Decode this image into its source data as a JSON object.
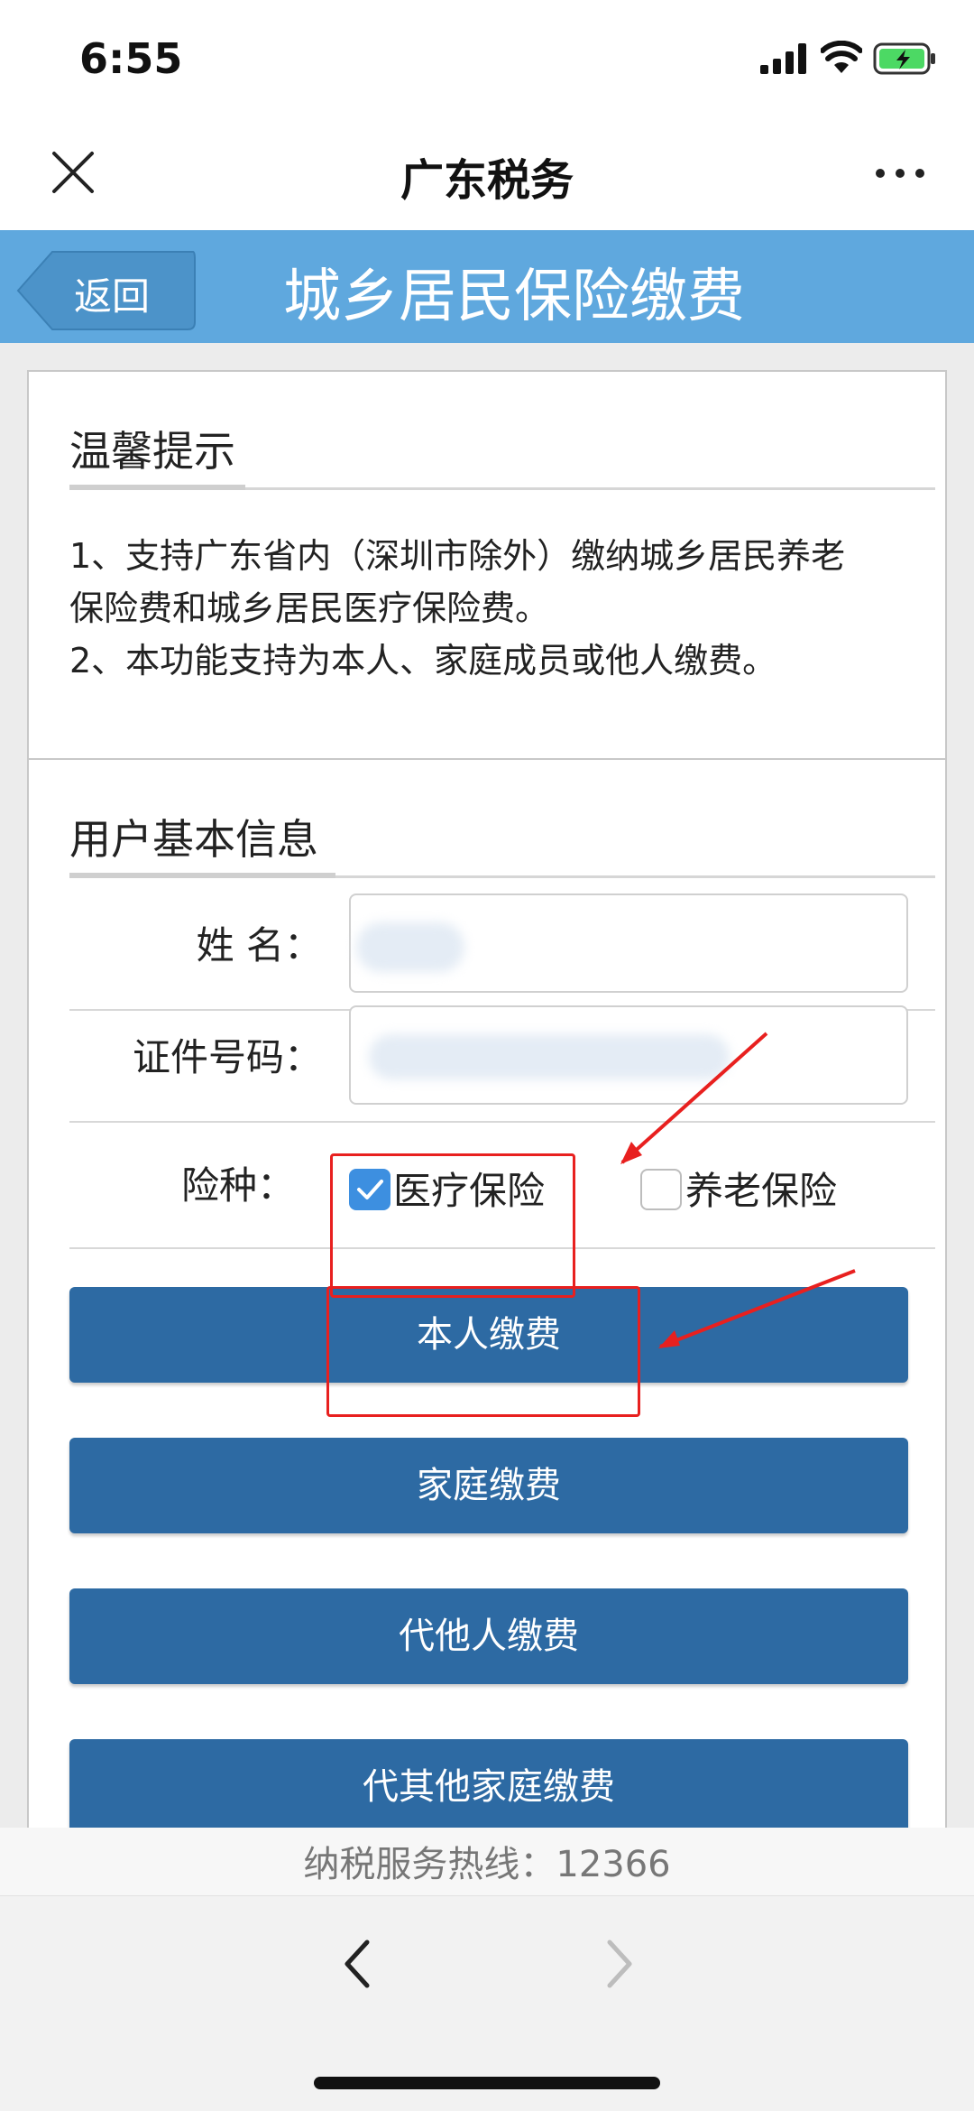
{
  "status_bar": {
    "time": "6:55"
  },
  "nav": {
    "title": "广东税务"
  },
  "header": {
    "back_label": "返回",
    "title": "城乡居民保险缴费"
  },
  "tips": {
    "heading": "温馨提示",
    "lines": [
      "1、支持广东省内（深圳市除外）缴纳城乡居民养老",
      "保险费和城乡居民医疗保险费。",
      "2、本功能支持为本人、家庭成员或他人缴费。"
    ]
  },
  "user_info": {
    "heading": "用户基本信息",
    "name_label": "姓  名：",
    "id_label": "证件号码：",
    "insurance_label": "险种：",
    "options": [
      {
        "label": "医疗保险",
        "checked": true
      },
      {
        "label": "养老保险",
        "checked": false
      }
    ]
  },
  "buttons": {
    "self_pay": "本人缴费",
    "family_pay": "家庭缴费",
    "others_pay": "代他人缴费",
    "other_family_pay": "代其他家庭缴费"
  },
  "footer": {
    "hotline": "纳税服务热线：12366"
  },
  "colors": {
    "header_blue": "#5fa8de",
    "button_blue": "#2d6aa3",
    "checkbox_blue": "#3d8fe0",
    "annotation_red": "#e8201f"
  }
}
